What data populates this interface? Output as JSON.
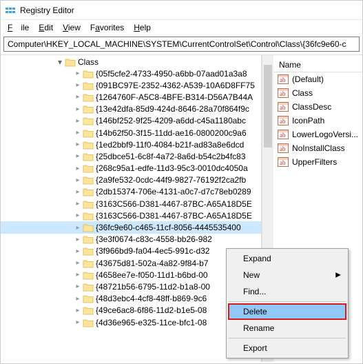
{
  "window": {
    "title": "Registry Editor"
  },
  "menubar": {
    "file": "File",
    "edit": "Edit",
    "view": "View",
    "favorites": "Favorites",
    "help": "Help"
  },
  "address": "Computer\\HKEY_LOCAL_MACHINE\\SYSTEM\\CurrentControlSet\\Control\\Class\\{36fc9e60-c",
  "tree": {
    "parent": "Class",
    "items": [
      "{05f5cfe2-4733-4950-a6bb-07aad01a3a8",
      "{091BC97E-2352-4362-A539-10A6D8FF75",
      "{1264760F-A5C8-4BFE-B314-D56A7B44A",
      "{13e42dfa-85d9-424d-8646-28a70f864f9c",
      "{146bf252-9f25-4209-a6dd-c45a1180abc",
      "{14b62f50-3f15-11dd-ae16-0800200c9a6",
      "{1ed2bbf9-11f0-4084-b21f-ad83a8e6dcd",
      "{25dbce51-6c8f-4a72-8a6d-b54c2b4fc83",
      "{268c95a1-edfe-11d3-95c3-0010dc4050a",
      "{2a9fe532-0cdc-44f9-9827-76192f2ca2fb",
      "{2db15374-706e-4131-a0c7-d7c78eb0289",
      "{3163C566-D381-4467-87BC-A65A18D5E",
      "{3163C566-D381-4467-87BC-A65A18D5E",
      "{36fc9e60-c465-11cf-8056-4445535400",
      "{3e3f0674-c83c-4558-bb26-982",
      "{3f966bd9-fa04-4ec5-991c-d32",
      "{43675d81-502a-4a82-9f84-b7",
      "{4658ee7e-f050-11d1-b6bd-00",
      "{48721b56-6795-11d2-b1a8-00",
      "{48d3ebc4-4cf8-48ff-b869-9c6",
      "{49ce6ac8-6f86-11d2-b1e5-08",
      "{4d36e965-e325-11ce-bfc1-08"
    ],
    "selected_index": 13
  },
  "values": {
    "header": "Name",
    "items": [
      "(Default)",
      "Class",
      "ClassDesc",
      "IconPath",
      "LowerLogoVersi...",
      "NoInstallClass",
      "UpperFilters"
    ]
  },
  "ctx": {
    "expand": "Expand",
    "new": "New",
    "find": "Find...",
    "delete": "Delete",
    "rename": "Rename",
    "export": "Export"
  }
}
